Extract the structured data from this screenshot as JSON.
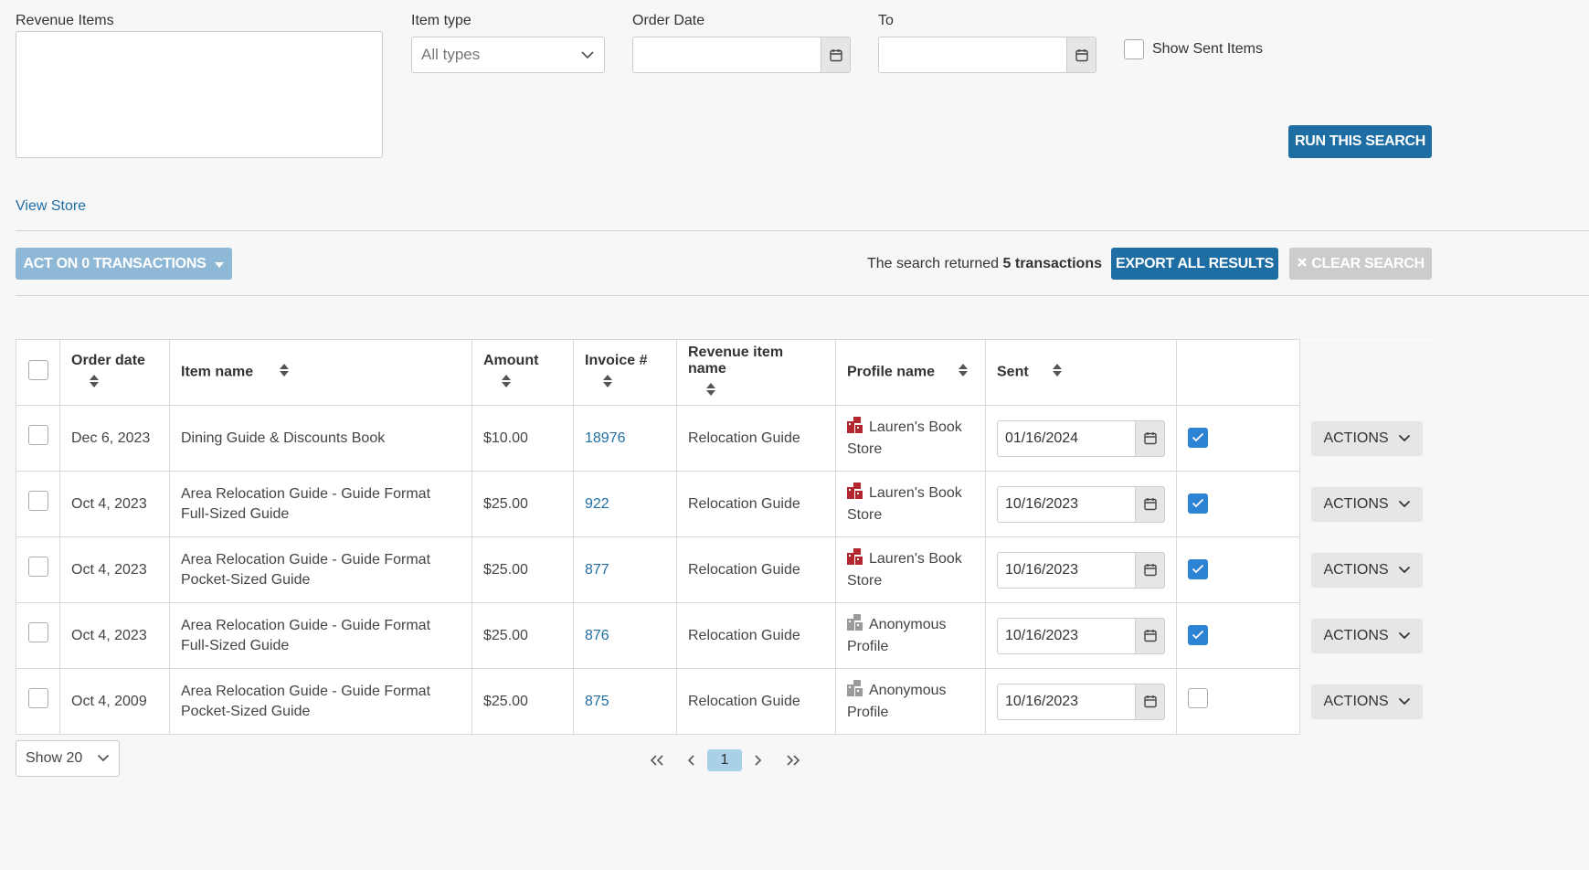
{
  "filters": {
    "revenue_items_label": "Revenue Items",
    "item_type_label": "Item type",
    "item_type_value": "All types",
    "order_date_label": "Order Date",
    "order_date_value": "",
    "to_label": "To",
    "to_value": "",
    "show_sent_label": "Show Sent Items",
    "run_search_label": "RUN THIS SEARCH"
  },
  "view_store_label": "View Store",
  "toolbar": {
    "act_on_label": "ACT ON 0 TRANSACTIONS",
    "result_prefix": "The search returned",
    "result_count": "5 transactions",
    "export_label": "EXPORT ALL RESULTS",
    "clear_label": "CLEAR SEARCH"
  },
  "table": {
    "headers": {
      "order_date": "Order date",
      "item_name": "Item name",
      "amount": "Amount",
      "invoice": "Invoice #",
      "revenue_item_name": "Revenue item name",
      "profile_name": "Profile name",
      "sent": "Sent"
    },
    "actions_label": "ACTIONS",
    "rows": [
      {
        "order_date": "Dec 6, 2023",
        "item_name": "Dining Guide & Discounts Book",
        "amount": "$10.00",
        "invoice": "18976",
        "revenue_item": "Relocation Guide",
        "profile": "Lauren's Book Store",
        "profile_icon": "store-icon",
        "sent_date": "01/16/2024",
        "sent": true
      },
      {
        "order_date": "Oct 4, 2023",
        "item_name": "Area Relocation Guide - Guide Format Full-Sized Guide",
        "amount": "$25.00",
        "invoice": "922",
        "revenue_item": "Relocation Guide",
        "profile": "Lauren's Book Store",
        "profile_icon": "store-icon",
        "sent_date": "10/16/2023",
        "sent": true
      },
      {
        "order_date": "Oct 4, 2023",
        "item_name": "Area Relocation Guide - Guide Format Pocket-Sized Guide",
        "amount": "$25.00",
        "invoice": "877",
        "revenue_item": "Relocation Guide",
        "profile": "Lauren's Book Store",
        "profile_icon": "store-icon",
        "sent_date": "10/16/2023",
        "sent": true
      },
      {
        "order_date": "Oct 4, 2023",
        "item_name": "Area Relocation Guide - Guide Format Full-Sized Guide",
        "amount": "$25.00",
        "invoice": "876",
        "revenue_item": "Relocation Guide",
        "profile": "Anonymous Profile",
        "profile_icon": "anonymous-profile-icon",
        "sent_date": "10/16/2023",
        "sent": true
      },
      {
        "order_date": "Oct 4, 2009",
        "item_name": "Area Relocation Guide - Guide Format Pocket-Sized Guide",
        "amount": "$25.00",
        "invoice": "875",
        "revenue_item": "Relocation Guide",
        "profile": "Anonymous Profile",
        "profile_icon": "anonymous-profile-icon",
        "sent_date": "10/16/2023",
        "sent": false
      }
    ]
  },
  "pagination": {
    "show_label": "Show 20",
    "current_page": "1"
  },
  "colors": {
    "primary": "#1f6ea3",
    "checkbox_checked": "#2d84d4",
    "store_icon": "#b3262e",
    "anonymous_icon": "#9a9a9a"
  }
}
